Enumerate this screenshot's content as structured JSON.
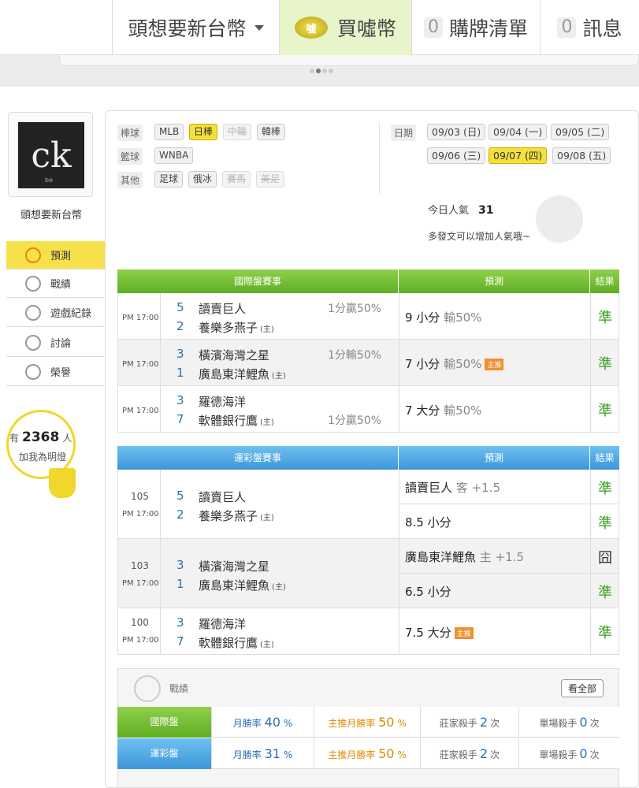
{
  "topnav": {
    "user_menu": "頭想要新台幣",
    "buy_coin": "買噓幣",
    "buy_coin_icon_text": "噓",
    "purchase_count": "0",
    "purchase_list": "購牌清單",
    "message_count": "0",
    "messages": "訊息"
  },
  "sidebar": {
    "avatar_text": "ck",
    "avatar_sub": "be",
    "username": "頭想要新台幣",
    "items": [
      {
        "label": "預測",
        "icon": "target-icon",
        "active": true
      },
      {
        "label": "戰績",
        "icon": "record-icon",
        "active": false
      },
      {
        "label": "遊戲紀錄",
        "icon": "circle-icon",
        "active": false
      },
      {
        "label": "討論",
        "icon": "discuss-icon",
        "active": false
      },
      {
        "label": "榮譽",
        "icon": "medal-icon",
        "active": false
      }
    ],
    "love_prefix": "有",
    "love_count": "2368",
    "love_suffix": "人",
    "love_line2": "加我為明燈"
  },
  "filters": {
    "baseball_label": "棒球",
    "basketball_label": "籃球",
    "other_label": "其他",
    "baseball": [
      "MLB",
      "日棒",
      "中職",
      "韓棒"
    ],
    "basketball": [
      "WNBA"
    ],
    "other": [
      "足球",
      "俄冰",
      "賽馬",
      "美足"
    ],
    "date_label": "日期",
    "dates": [
      "09/03 (日)",
      "09/04 (一)",
      "09/05 (二)",
      "09/06 (三)",
      "09/07 (四)",
      "09/08 (五)"
    ]
  },
  "popularity": {
    "label": "今日人氣",
    "value": "31",
    "tip": "多發文可以增加人氣哦~"
  },
  "intl": {
    "headers": [
      "國際盤賽事",
      "預測",
      "結果"
    ],
    "rows": [
      {
        "time": "PM 17:00",
        "s1": "5",
        "t1": "讀賣巨人",
        "h1": "",
        "s2": "2",
        "t2": "養樂多燕子",
        "h2": "(主)",
        "odds1": "1分贏50%",
        "odds2": "",
        "pick": "9 小分",
        "pick_g": "輸50%",
        "tag": "",
        "result": "準"
      },
      {
        "time": "PM 17:00",
        "s1": "3",
        "t1": "橫濱海灣之星",
        "h1": "",
        "s2": "1",
        "t2": "廣島東洋鯉魚",
        "h2": "(主)",
        "odds1": "1分輸50%",
        "odds2": "",
        "pick": "7 小分",
        "pick_g": "輸50%",
        "tag": "主推",
        "result": "準"
      },
      {
        "time": "PM 17:00",
        "s1": "3",
        "t1": "羅德海洋",
        "h1": "",
        "s2": "7",
        "t2": "軟體銀行鷹",
        "h2": "(主)",
        "odds1": "",
        "odds2": "1分贏50%",
        "pick": "7 大分",
        "pick_g": "輸50%",
        "tag": "",
        "result": "準"
      }
    ]
  },
  "lottery": {
    "headers": [
      "運彩盤賽事",
      "預測",
      "結果"
    ],
    "rows": [
      {
        "no": "105",
        "time": "PM 17:00",
        "s1": "5",
        "t1": "讀賣巨人",
        "h1": "",
        "s2": "2",
        "t2": "養樂多燕子",
        "h2": "(主)",
        "pick1": "讀賣巨人",
        "pick1_g": "客 +1.5",
        "tag1": "",
        "res1": "準",
        "pick2": "8.5 小分",
        "pick2_g": "",
        "tag2": "",
        "res2": "準"
      },
      {
        "no": "103",
        "time": "PM 17:00",
        "s1": "3",
        "t1": "橫濱海灣之星",
        "h1": "",
        "s2": "1",
        "t2": "廣島東洋鯉魚",
        "h2": "(主)",
        "pick1": "廣島東洋鯉魚",
        "pick1_g": "主 +1.5",
        "tag1": "",
        "res1": "囧",
        "pick2": "6.5 小分",
        "pick2_g": "",
        "tag2": "",
        "res2": "準"
      },
      {
        "no": "100",
        "time": "PM 17:00",
        "s1": "3",
        "t1": "羅德海洋",
        "h1": "",
        "s2": "7",
        "t2": "軟體銀行鷹",
        "h2": "(主)",
        "pick1": "7.5 大分",
        "pick1_g": "",
        "tag1": "主推",
        "res1": "準"
      }
    ]
  },
  "record": {
    "title": "戰績",
    "view_all": "看全部",
    "rows": [
      {
        "label": "國際盤",
        "rate_label": "月勝率",
        "rate": "40",
        "main_label": "主推月勝率",
        "main_rate": "50",
        "pct": "%",
        "killer_label": "莊家殺手",
        "killer": "2",
        "single_label": "單場殺手",
        "single": "0",
        "unit": "次"
      },
      {
        "label": "運彩盤",
        "rate_label": "月勝率",
        "rate": "31",
        "main_label": "主推月勝率",
        "main_rate": "50",
        "pct": "%",
        "killer_label": "莊家殺手",
        "killer": "2",
        "single_label": "單場殺手",
        "single": "0",
        "unit": "次"
      }
    ]
  },
  "colors": {
    "accent_yellow": "#f4e03c",
    "intl_green": "#6ab82a",
    "lottery_blue": "#4aa3e0",
    "result_green": "#3b9f1f",
    "tag_orange": "#f09030"
  }
}
